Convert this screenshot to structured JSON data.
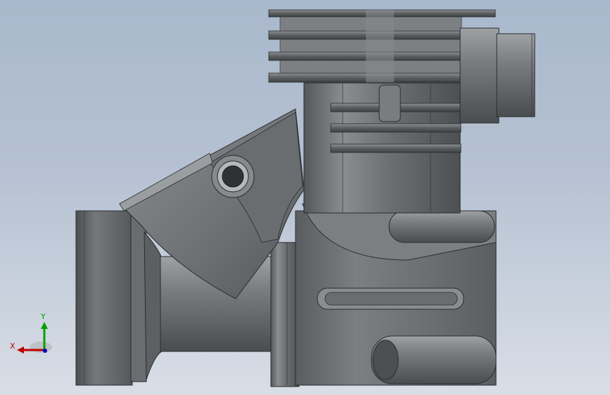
{
  "viewport": {
    "background_top": "#a9b8cc",
    "background_bottom": "#d9dee6",
    "model_color": "#6f7275"
  },
  "triad": {
    "x_label": "X",
    "y_label": "Y",
    "x_color": "#c00000",
    "y_color": "#00a000",
    "z_color": "#0000c0"
  }
}
